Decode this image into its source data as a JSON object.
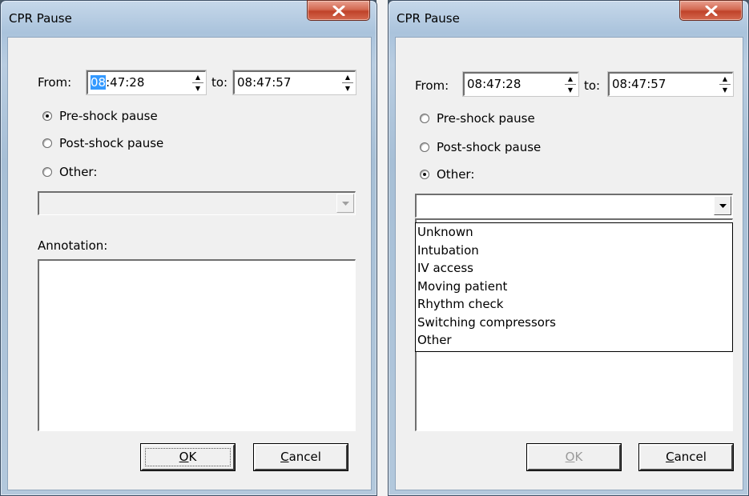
{
  "dialog1": {
    "title": "CPR Pause",
    "from_label": "From:",
    "from_hour_selected": "08",
    "from_rest": ":47:28",
    "to_label": "to:",
    "to_value": "08:47:57",
    "radio_pre": "Pre-shock pause",
    "radio_post": "Post-shock pause",
    "radio_other": "Other:",
    "selected_radio": "Pre-shock pause",
    "other_combo_value": "",
    "annotation_label": "Annotation:",
    "annotation_value": "",
    "ok_mnemonic": "O",
    "ok_rest": "K",
    "cancel_mnemonic": "C",
    "cancel_rest": "ancel"
  },
  "dialog2": {
    "title": "CPR Pause",
    "from_label": "From:",
    "from_value": "08:47:28",
    "to_label": "to:",
    "to_value": "08:47:57",
    "radio_pre": "Pre-shock pause",
    "radio_post": "Post-shock pause",
    "radio_other": "Other:",
    "selected_radio": "Other:",
    "other_combo_value": "",
    "dropdown_options": [
      "Unknown",
      "Intubation",
      "IV access",
      "Moving patient",
      "Rhythm check",
      "Switching compressors",
      "Other"
    ],
    "ok_mnemonic": "O",
    "ok_rest": "K",
    "ok_enabled": false,
    "cancel_mnemonic": "C",
    "cancel_rest": "ancel"
  },
  "icons": {
    "close": "close-x-icon",
    "spin": "spin-arrows-icon",
    "dropdown": "chevron-down-icon"
  }
}
